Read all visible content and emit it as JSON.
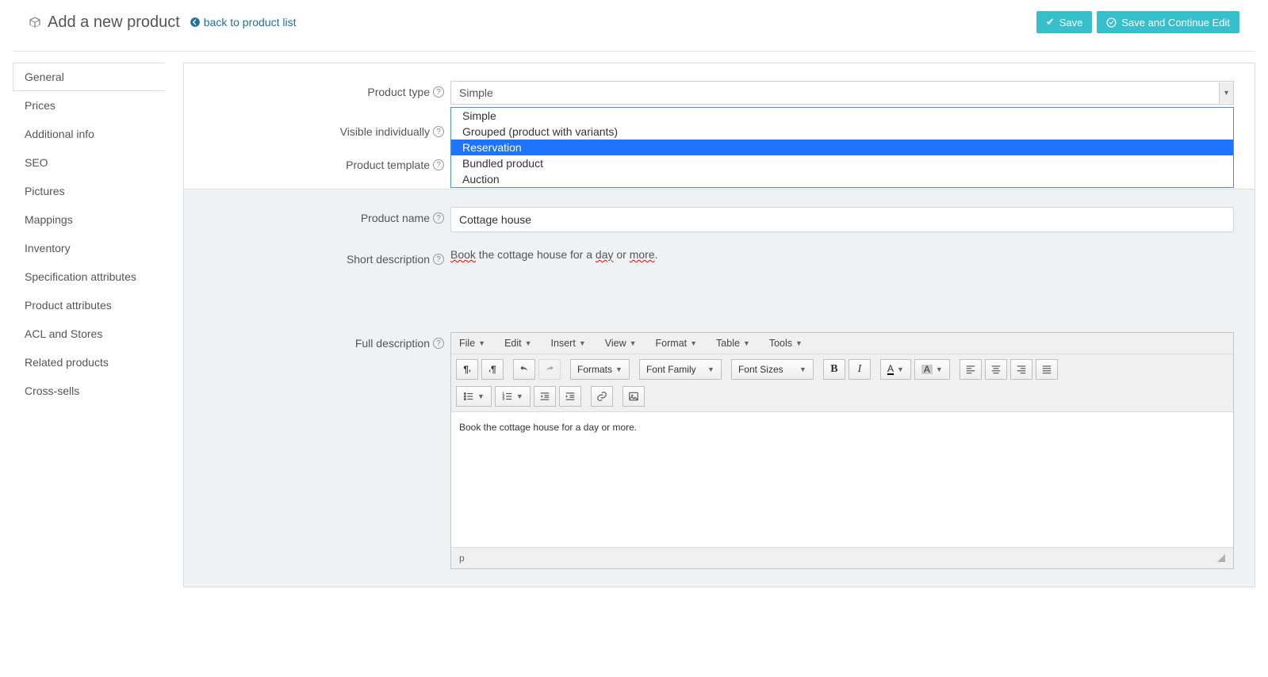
{
  "header": {
    "title": "Add a new product",
    "back_label": "back to product list",
    "save_label": "Save",
    "save_continue_label": "Save and Continue Edit"
  },
  "tabs": [
    {
      "label": "General",
      "active": true
    },
    {
      "label": "Prices"
    },
    {
      "label": "Additional info"
    },
    {
      "label": "SEO"
    },
    {
      "label": "Pictures"
    },
    {
      "label": "Mappings"
    },
    {
      "label": "Inventory"
    },
    {
      "label": "Specification attributes"
    },
    {
      "label": "Product attributes"
    },
    {
      "label": "ACL and Stores"
    },
    {
      "label": "Related products"
    },
    {
      "label": "Cross-sells"
    }
  ],
  "form": {
    "product_type": {
      "label": "Product type",
      "value": "Simple",
      "options": [
        {
          "label": "Simple"
        },
        {
          "label": "Grouped (product with variants)"
        },
        {
          "label": "Reservation",
          "highlighted": true
        },
        {
          "label": "Bundled product"
        },
        {
          "label": "Auction"
        }
      ]
    },
    "visible_individually": {
      "label": "Visible individually"
    },
    "product_template": {
      "label": "Product template"
    },
    "product_name": {
      "label": "Product name",
      "value": "Cottage house"
    },
    "short_description": {
      "label": "Short description",
      "value": "Book the cottage house for a day or more.",
      "tokens": [
        {
          "t": "Book",
          "red": true
        },
        {
          "t": " the cottage house for a "
        },
        {
          "t": "day",
          "red": true
        },
        {
          "t": " or "
        },
        {
          "t": "more",
          "red": true
        },
        {
          "t": "."
        }
      ]
    },
    "full_description": {
      "label": "Full description",
      "body": "Book the cottage house for a day or more."
    }
  },
  "editor": {
    "menu": [
      "File",
      "Edit",
      "Insert",
      "View",
      "Format",
      "Table",
      "Tools"
    ],
    "formats_label": "Formats",
    "font_family_label": "Font Family",
    "font_sizes_label": "Font Sizes",
    "status": "p"
  }
}
